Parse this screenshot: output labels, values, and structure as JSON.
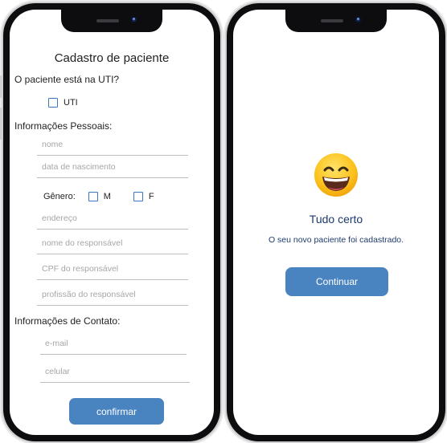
{
  "left_screen": {
    "title": "Cadastro de paciente",
    "uti_question": "O paciente está na UTI?",
    "uti_option": "UTI",
    "personal_section": "Informações Pessoais:",
    "name_placeholder": "nome",
    "birth_placeholder": "data de nascimento",
    "gender_label": "Gênero:",
    "gender_m": "M",
    "gender_f": "F",
    "address_placeholder": "endereço",
    "guardian_name_placeholder": "nome do responsável",
    "guardian_cpf_placeholder": "CPF do responsável",
    "guardian_job_placeholder": "profissão do responsável",
    "contact_section": "Informações de Contato:",
    "email_placeholder": "e-mail",
    "phone_placeholder": "celular",
    "confirm_label": "confirmar"
  },
  "right_screen": {
    "emoji": "grinning-face-icon",
    "title": "Tudo certo",
    "message": "O seu novo paciente foi cadastrado.",
    "continue_label": "Continuar"
  },
  "colors": {
    "accent": "#4a84c0",
    "checkbox_border": "#3a78c2",
    "success_text": "#1d3a6b",
    "frame": "#0d0d0f"
  }
}
